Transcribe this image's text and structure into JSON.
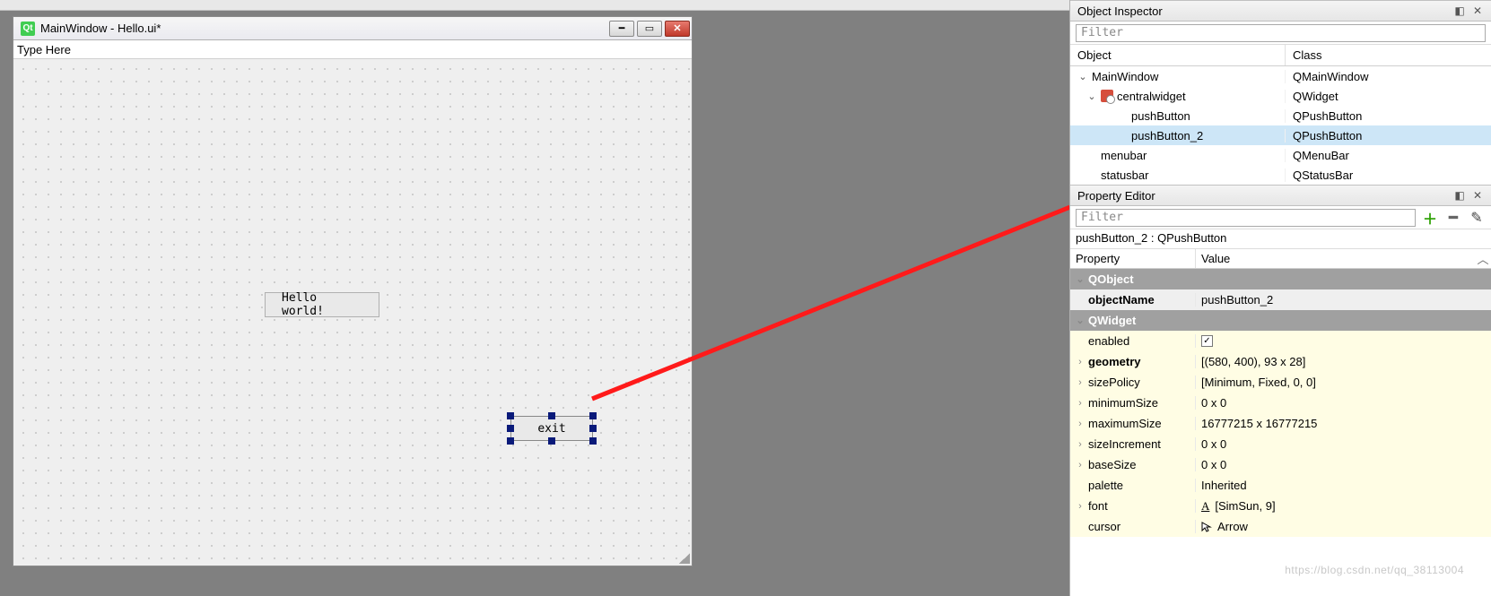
{
  "designer": {
    "title": "MainWindow - Hello.ui*",
    "menubar_placeholder": "Type Here",
    "buttons": {
      "hello": "Hello world!",
      "exit": "exit"
    },
    "qt_logo": "Qt"
  },
  "inspector": {
    "title": "Object Inspector",
    "filter_placeholder": "Filter",
    "cols": {
      "object": "Object",
      "class": "Class"
    },
    "rows": [
      {
        "name": "MainWindow",
        "class": "QMainWindow",
        "level": 0,
        "expander": "v"
      },
      {
        "name": "centralwidget",
        "class": "QWidget",
        "level": 1,
        "expander": "v",
        "icon": true
      },
      {
        "name": "pushButton",
        "class": "QPushButton",
        "level": 2
      },
      {
        "name": "pushButton_2",
        "class": "QPushButton",
        "level": 2,
        "selected": true
      },
      {
        "name": "menubar",
        "class": "QMenuBar",
        "level": 1
      },
      {
        "name": "statusbar",
        "class": "QStatusBar",
        "level": 1
      }
    ]
  },
  "propeditor": {
    "title": "Property Editor",
    "filter_placeholder": "Filter",
    "object_caption": "pushButton_2 : QPushButton",
    "cols": {
      "prop": "Property",
      "val": "Value"
    },
    "cat1": "QObject",
    "objectName_label": "objectName",
    "objectName_value": "pushButton_2",
    "cat2": "QWidget",
    "rows": [
      {
        "name": "enabled",
        "value": "",
        "check": true
      },
      {
        "name": "geometry",
        "value": "[(580, 400), 93 x 28]",
        "bold": true,
        "exp": true
      },
      {
        "name": "sizePolicy",
        "value": "[Minimum, Fixed, 0, 0]",
        "exp": true
      },
      {
        "name": "minimumSize",
        "value": "0 x 0",
        "exp": true
      },
      {
        "name": "maximumSize",
        "value": "16777215 x 16777215",
        "exp": true
      },
      {
        "name": "sizeIncrement",
        "value": "0 x 0",
        "exp": true
      },
      {
        "name": "baseSize",
        "value": "0 x 0",
        "exp": true
      },
      {
        "name": "palette",
        "value": "Inherited"
      },
      {
        "name": "font",
        "value": "[SimSun, 9]",
        "exp": true,
        "fonticon": true
      },
      {
        "name": "cursor",
        "value": "Arrow",
        "cursoricon": true
      }
    ]
  },
  "watermark": "https://blog.csdn.net/qq_38113004"
}
